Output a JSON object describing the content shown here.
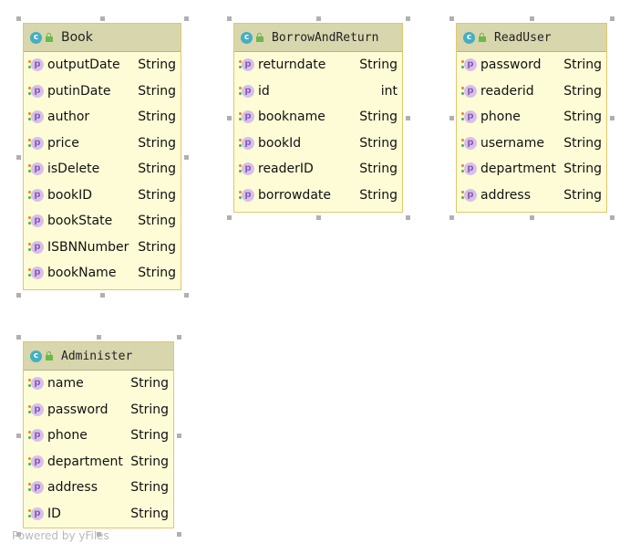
{
  "classes": [
    {
      "name": "Book",
      "fields": [
        {
          "name": "outputDate",
          "type": "String"
        },
        {
          "name": "putinDate",
          "type": "String"
        },
        {
          "name": "author",
          "type": "String"
        },
        {
          "name": "price",
          "type": "String"
        },
        {
          "name": "isDelete",
          "type": "String"
        },
        {
          "name": "bookID",
          "type": "String"
        },
        {
          "name": "bookState",
          "type": "String"
        },
        {
          "name": "ISBNNumber",
          "type": "String"
        },
        {
          "name": "bookName",
          "type": "String"
        }
      ]
    },
    {
      "name": "BorrowAndReturn",
      "fields": [
        {
          "name": "returndate",
          "type": "String"
        },
        {
          "name": "id",
          "type": "int"
        },
        {
          "name": "bookname",
          "type": "String"
        },
        {
          "name": "bookId",
          "type": "String"
        },
        {
          "name": "readerID",
          "type": "String"
        },
        {
          "name": "borrowdate",
          "type": "String"
        }
      ]
    },
    {
      "name": "ReadUser",
      "fields": [
        {
          "name": "password",
          "type": "String"
        },
        {
          "name": "readerid",
          "type": "String"
        },
        {
          "name": "phone",
          "type": "String"
        },
        {
          "name": "username",
          "type": "String"
        },
        {
          "name": "department",
          "type": "String"
        },
        {
          "name": "address",
          "type": "String"
        }
      ]
    },
    {
      "name": "Administer",
      "fields": [
        {
          "name": "name",
          "type": "String"
        },
        {
          "name": "password",
          "type": "String"
        },
        {
          "name": "phone",
          "type": "String"
        },
        {
          "name": "department",
          "type": "String"
        },
        {
          "name": "address",
          "type": "String"
        },
        {
          "name": "ID",
          "type": "String"
        }
      ]
    }
  ],
  "icons": {
    "class": "c",
    "field": "p"
  },
  "watermark": "Powered by yFiles"
}
